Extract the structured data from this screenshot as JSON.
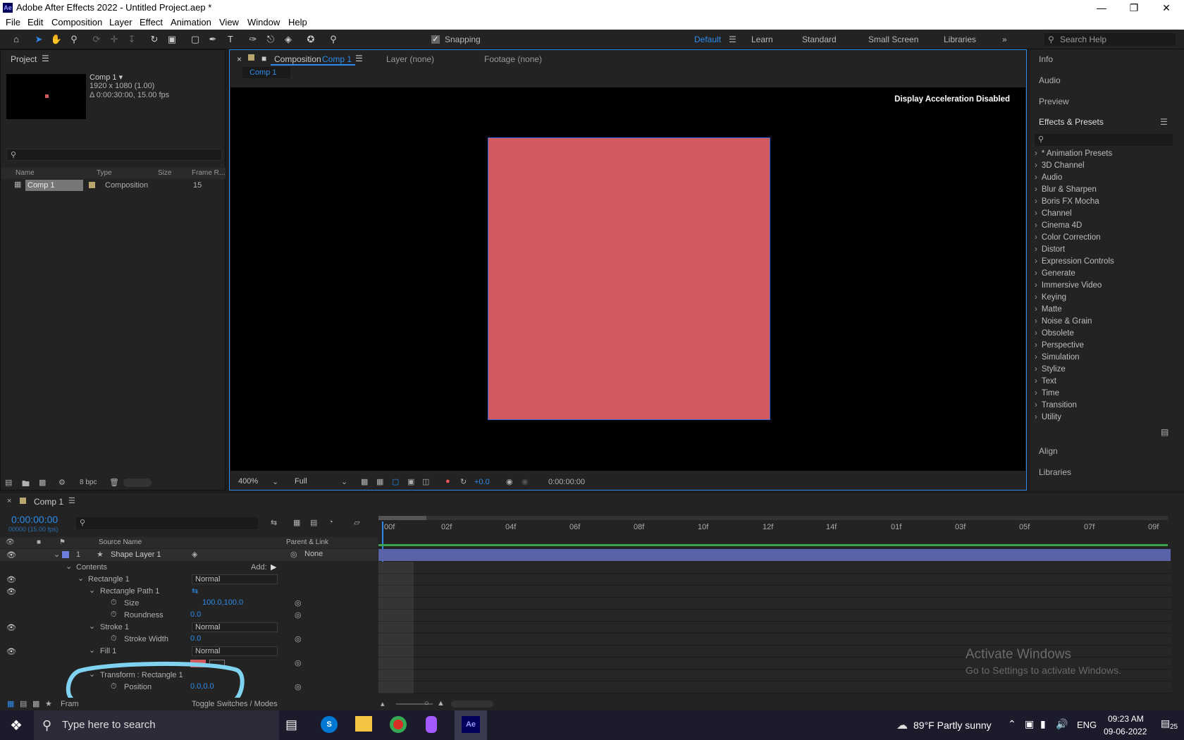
{
  "window": {
    "title": "Adobe After Effects 2022 - Untitled Project.aep *",
    "logo": "Ae"
  },
  "menu": [
    "File",
    "Edit",
    "Composition",
    "Layer",
    "Effect",
    "Animation",
    "View",
    "Window",
    "Help"
  ],
  "toolbar": {
    "snapping": "Snapping",
    "workspaces": [
      "Default",
      "Learn",
      "Standard",
      "Small Screen",
      "Libraries"
    ],
    "search_placeholder": "Search Help"
  },
  "project": {
    "title": "Project",
    "comp_name": "Comp 1 ▾",
    "comp_res": "1920 x 1080 (1.00)",
    "comp_dur": "Δ 0:00:30:00, 15.00 fps",
    "columns": [
      "Name",
      "Type",
      "Size",
      "Frame R..."
    ],
    "row": {
      "name": "Comp 1",
      "type": "Composition",
      "frame_rate": "15"
    },
    "bpc": "8 bpc"
  },
  "composition": {
    "tab_prefix": "Composition",
    "tab_name": "Comp 1",
    "layer_tab": "Layer (none)",
    "footage_tab": "Footage (none)",
    "breadcrumb": "Comp 1",
    "notice": "Display Acceleration Disabled",
    "zoom": "400%",
    "resolution": "Full",
    "exposure": "+0.0",
    "timecode": "0:00:00:00"
  },
  "right": {
    "top": [
      "Info",
      "Audio",
      "Preview"
    ],
    "effects_title": "Effects & Presets",
    "effects": [
      "* Animation Presets",
      "3D Channel",
      "Audio",
      "Blur & Sharpen",
      "Boris FX Mocha",
      "Channel",
      "Cinema 4D",
      "Color Correction",
      "Distort",
      "Expression Controls",
      "Generate",
      "Immersive Video",
      "Keying",
      "Matte",
      "Noise & Grain",
      "Obsolete",
      "Perspective",
      "Simulation",
      "Stylize",
      "Text",
      "Time",
      "Transition",
      "Utility"
    ],
    "bottom": [
      "Align",
      "Libraries"
    ]
  },
  "timeline": {
    "tab": "Comp 1",
    "timecode": "0:00:00:00",
    "frames": "00000 (15.00 fps)",
    "source_name": "Source Name",
    "parent_link": "Parent & Link",
    "ticks": [
      "00f",
      "02f",
      "04f",
      "06f",
      "08f",
      "10f",
      "12f",
      "14f",
      "01f",
      "03f",
      "05f",
      "07f",
      "09f"
    ],
    "layer": {
      "num": "1",
      "name": "Shape Layer 1",
      "parent": "None"
    },
    "contents": "Contents",
    "add": "Add:",
    "rect": "Rectangle 1",
    "rect_mode": "Normal",
    "path": "Rectangle Path 1",
    "size_label": "Size",
    "size_value": "100.0,100.0",
    "round_label": "Roundness",
    "round_value": "0.0",
    "stroke": "Stroke 1",
    "stroke_mode": "Normal",
    "sw_label": "Stroke Width",
    "sw_value": "0.0",
    "fill": "Fill 1",
    "fill_mode": "Normal",
    "transform": "Transform : Rectangle 1",
    "pos_label": "Position",
    "pos_value": "0.0,0.0",
    "toggle": "Toggle Switches / Modes",
    "frame_label": "Fram"
  },
  "activate": {
    "line1": "Activate Windows",
    "line2": "Go to Settings to activate Windows."
  },
  "taskbar": {
    "search": "Type here to search",
    "weather": "89°F  Partly sunny",
    "lang": "ENG",
    "time": "09:23 AM",
    "date": "09-06-2022",
    "notif": "25"
  },
  "colors": {
    "accent": "#2d8ceb",
    "shape": "#d2595d",
    "annotation": "#7fd3f0"
  }
}
